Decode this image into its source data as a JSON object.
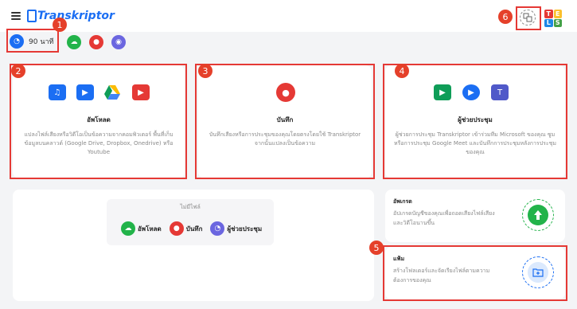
{
  "app": {
    "logo": "Transkriptor"
  },
  "credits": {
    "label": "90 นาที"
  },
  "cards": {
    "upload": {
      "title": "อัพโหลด",
      "desc": "แปลงไฟล์เสียงหรือวิดีโอเป็นข้อความจากคอมพิวเตอร์ พื้นที่เก็บข้อมูลบนคลาวด์ (Google Drive, Dropbox, Onedrive) หรือ Youtube"
    },
    "record": {
      "title": "บันทึก",
      "desc": "บันทึกเสียงหรือการประชุมของคุณโดยตรงโดยใช้ Transkriptor จากนั้นแปลงเป็นข้อความ"
    },
    "assistant": {
      "title": "ผู้ช่วยประชุม",
      "desc": "ผู้ช่วยการประชุม Transkriptor เข้าร่วมทีม Microsoft ของคุณ ซูมหรือการประชุม Google Meet และบันทึกการประชุมหลังการประชุมของคุณ"
    }
  },
  "empty": {
    "title": "ไม่มีไฟล์",
    "actions": {
      "upload": "อัพโหลด",
      "record": "บันทึก",
      "assistant": "ผู้ช่วยประชุม"
    }
  },
  "upgrade": {
    "title": "อัพเกรด",
    "desc": "อัปเกรดบัญชีของคุณเพื่อถอดเสียงไฟล์เสียงและวิดีโอนานขึ้น"
  },
  "folder": {
    "title": "แฟ้ม",
    "desc": "สร้างโฟลเดอร์และจัดเรียงไฟล์ตามความต้องการของคุณ"
  },
  "badges": {
    "b1": "1",
    "b2": "2",
    "b3": "3",
    "b4": "4",
    "b5": "5",
    "b6": "6"
  },
  "lang": {
    "t": "T",
    "e": "E",
    "l": "L",
    "s": "S"
  },
  "colors": {
    "blue": "#1b6ef3",
    "green": "#22b34a",
    "red": "#e53935",
    "purple": "#6b66e0",
    "annotation": "#e53935"
  }
}
